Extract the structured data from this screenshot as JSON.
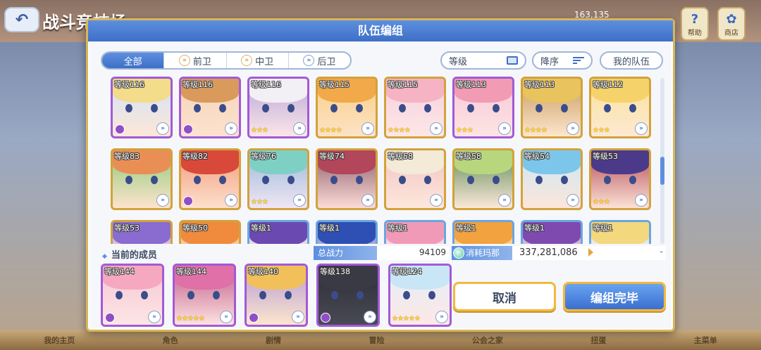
{
  "background": {
    "title": "战斗竞技场",
    "coins": "163,135",
    "help_label": "帮助",
    "shop_label": "商店",
    "nav": [
      "我的主页",
      "角色",
      "剧情",
      "冒险",
      "公会之家",
      "扭蛋",
      "主菜单"
    ]
  },
  "modal": {
    "title": "队伍编组",
    "tabs": [
      {
        "label": "全部",
        "active": true
      },
      {
        "label": "前卫",
        "active": false
      },
      {
        "label": "中卫",
        "active": false
      },
      {
        "label": "后卫",
        "active": false
      }
    ],
    "sort_level_label": "等级",
    "sort_order_label": "降序",
    "my_team_label": "我的队伍",
    "characters": [
      {
        "level": "等级116",
        "frame": "purple",
        "stars": "",
        "rank": true,
        "hair": "#f3dc8a",
        "skin": "#fde7d6",
        "bg": "#cfe3fb"
      },
      {
        "level": "等级116",
        "frame": "purple",
        "stars": "",
        "rank": true,
        "hair": "#d99a5c",
        "skin": "#fde2cf",
        "bg": "#f5d4b8"
      },
      {
        "level": "等级116",
        "frame": "purple",
        "stars": "★★★",
        "rank": false,
        "hair": "#f2f0f4",
        "skin": "#fbe6e8",
        "bg": "#b9a6d8"
      },
      {
        "level": "等级115",
        "frame": "gold",
        "stars": "★★★★",
        "rank": false,
        "hair": "#f1a94a",
        "skin": "#fde2c6",
        "bg": "#f8cf85"
      },
      {
        "level": "等级115",
        "frame": "gold",
        "stars": "★★★★",
        "rank": false,
        "hair": "#f6b3c4",
        "skin": "#fde7e6",
        "bg": "#f6cfe0"
      },
      {
        "level": "等级113",
        "frame": "purple",
        "stars": "★★★",
        "rank": false,
        "hair": "#f29bb5",
        "skin": "#fde5e3",
        "bg": "#f7c6d8"
      },
      {
        "level": "等级113",
        "frame": "gold",
        "stars": "★★★★",
        "rank": false,
        "hair": "#e9c45e",
        "skin": "#fde6cc",
        "bg": "#c89a5d"
      },
      {
        "level": "等级112",
        "frame": "gold",
        "stars": "★★★",
        "rank": false,
        "hair": "#f5d36a",
        "skin": "#fde9d3",
        "bg": "#fbe19a"
      },
      {
        "level": "等级83",
        "frame": "gold",
        "stars": "",
        "rank": false,
        "hair": "#e98f56",
        "skin": "#fde3cc",
        "bg": "#8ecb7a"
      },
      {
        "level": "等级82",
        "frame": "gold",
        "stars": "",
        "rank": true,
        "hair": "#d8493a",
        "skin": "#fde0cc",
        "bg": "#f29a7a"
      },
      {
        "level": "等级76",
        "frame": "gold",
        "stars": "★★★",
        "rank": false,
        "hair": "#7fd0c4",
        "skin": "#f0e6f4",
        "bg": "#9ab8d8"
      },
      {
        "level": "等级74",
        "frame": "gold",
        "stars": "",
        "rank": false,
        "hair": "#b2465a",
        "skin": "#fcdcd6",
        "bg": "#8a5a6a"
      },
      {
        "level": "等级58",
        "frame": "gold",
        "stars": "",
        "rank": false,
        "hair": "#f3ead8",
        "skin": "#fde8dc",
        "bg": "#f1c2c4"
      },
      {
        "level": "等级58",
        "frame": "gold",
        "stars": "",
        "rank": false,
        "hair": "#b8d67e",
        "skin": "#fbe8d8",
        "bg": "#5e8a56"
      },
      {
        "level": "等级54",
        "frame": "gold",
        "stars": "",
        "rank": false,
        "hair": "#7cc6ec",
        "skin": "#fde6da",
        "bg": "#c9e8f6"
      },
      {
        "level": "等级53",
        "frame": "gold",
        "stars": "★★★",
        "rank": false,
        "hair": "#4b3a8a",
        "skin": "#fbe2d6",
        "bg": "#b64a56"
      },
      {
        "level": "等级53",
        "frame": "gold",
        "stars": "",
        "rank": false,
        "hair": "#8a6bd0",
        "skin": "#fde6dc",
        "bg": "#bfa8e6"
      },
      {
        "level": "等级50",
        "frame": "gold",
        "stars": "",
        "rank": false,
        "hair": "#f08a3c",
        "skin": "#fde3cc",
        "bg": "#f2b786"
      },
      {
        "level": "等级1",
        "frame": "blue",
        "stars": "",
        "rank": false,
        "hair": "#6a4ab0",
        "skin": "#fde6dc",
        "bg": "#d8cfe8"
      },
      {
        "level": "等级1",
        "frame": "blue",
        "stars": "",
        "rank": false,
        "hair": "#2e4fb4",
        "skin": "#fde6dc",
        "bg": "#6f86d6"
      },
      {
        "level": "等级1",
        "frame": "blue",
        "stars": "",
        "rank": false,
        "hair": "#f19ab8",
        "skin": "#fde6e2",
        "bg": "#f5cad8"
      },
      {
        "level": "等级1",
        "frame": "blue",
        "stars": "",
        "rank": false,
        "hair": "#f2a23e",
        "skin": "#fde3c8",
        "bg": "#f6c670"
      },
      {
        "level": "等级1",
        "frame": "blue",
        "stars": "",
        "rank": false,
        "hair": "#7e4ab0",
        "skin": "#fde6dc",
        "bg": "#b69ad6"
      },
      {
        "level": "等级1",
        "frame": "blue",
        "stars": "",
        "rank": false,
        "hair": "#f3d87e",
        "skin": "#fde9d3",
        "bg": "#dbe9f6"
      }
    ],
    "current_members_label": "当前的成员",
    "total_power_label": "总战力",
    "total_power_value": "94109",
    "mana_cost_label": "消耗玛那",
    "mana_cost_value": "337,281,086",
    "mana_suffix": "-",
    "members": [
      {
        "level": "等级144",
        "frame": "purple",
        "stars": "",
        "rank": true,
        "hair": "#f6a8c0",
        "skin": "#fde6e4",
        "bg": "#f5c6d6"
      },
      {
        "level": "等级144",
        "frame": "purple",
        "stars": "★★★★★",
        "rank": false,
        "hair": "#e070a8",
        "skin": "#fde2e0",
        "bg": "#c05a8a"
      },
      {
        "level": "等级140",
        "frame": "purple",
        "stars": "",
        "rank": true,
        "hair": "#f2c05a",
        "skin": "#fde5cc",
        "bg": "#b49ad8"
      },
      {
        "level": "等级138",
        "frame": "purple",
        "stars": "",
        "rank": true,
        "hair": "#3a3a44",
        "skin": "#4a4a56",
        "bg": "#2c2c36"
      },
      {
        "level": "等级124",
        "frame": "purple",
        "stars": "★★★★★",
        "rank": false,
        "hair": "#c8e6f6",
        "skin": "#fde8e6",
        "bg": "#e3eef8"
      }
    ],
    "cancel_label": "取消",
    "confirm_label": "编组完毕"
  }
}
